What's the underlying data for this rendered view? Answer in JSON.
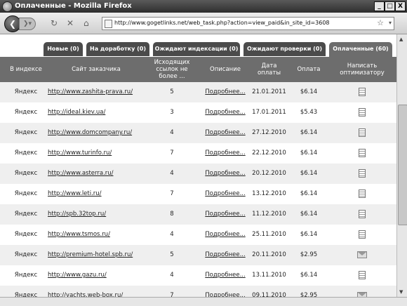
{
  "window": {
    "title": "Оплаченные - Mozilla Firefox",
    "buttons": [
      "_",
      "□",
      "X"
    ]
  },
  "nav": {
    "url": "http://www.gogetlinks.net/web_task.php?action=view_paid&in_site_id=3608",
    "icons": [
      "back-icon",
      "forward-icon",
      "reload-icon",
      "stop-icon",
      "home-icon",
      "star-icon"
    ]
  },
  "tabs": [
    {
      "label": "Новые (0)"
    },
    {
      "label": "На доработку (0)"
    },
    {
      "label": "Ожидают индексации (0)"
    },
    {
      "label": "Ожидают проверки (0)"
    },
    {
      "label": "Оплаченные (60)"
    }
  ],
  "table": {
    "headers": [
      "В индексе",
      "Сайт заказчика",
      "Исходящих ссылок не более ...",
      "Описание",
      "Дата оплаты",
      "Оплата",
      "Написать оптимизатору"
    ],
    "rows": [
      {
        "idx": "Яндекс",
        "site": "http://www.zashita-prava.ru/",
        "links": "5",
        "desc": "Подробнее...",
        "date": "21.01.2011",
        "pay": "$6.14",
        "msg": "note"
      },
      {
        "idx": "Яндекс",
        "site": "http://ideal.kiev.ua/",
        "links": "3",
        "desc": "Подробнее...",
        "date": "17.01.2011",
        "pay": "$5.43",
        "msg": "note"
      },
      {
        "idx": "Яндекс",
        "site": "http://www.domcompany.ru/",
        "links": "4",
        "desc": "Подробнее...",
        "date": "27.12.2010",
        "pay": "$6.14",
        "msg": "note"
      },
      {
        "idx": "Яндекс",
        "site": "http://www.turinfo.ru/",
        "links": "7",
        "desc": "Подробнее...",
        "date": "22.12.2010",
        "pay": "$6.14",
        "msg": "note"
      },
      {
        "idx": "Яндекс",
        "site": "http://www.asterra.ru/",
        "links": "4",
        "desc": "Подробнее...",
        "date": "20.12.2010",
        "pay": "$6.14",
        "msg": "note"
      },
      {
        "idx": "Яндекс",
        "site": "http://www.leti.ru/",
        "links": "7",
        "desc": "Подробнее...",
        "date": "13.12.2010",
        "pay": "$6.14",
        "msg": "note"
      },
      {
        "idx": "Яндекс",
        "site": "http://spb.32top.ru/",
        "links": "8",
        "desc": "Подробнее...",
        "date": "11.12.2010",
        "pay": "$6.14",
        "msg": "note"
      },
      {
        "idx": "Яндекс",
        "site": "http://www.tsmos.ru/",
        "links": "4",
        "desc": "Подробнее...",
        "date": "25.11.2010",
        "pay": "$6.14",
        "msg": "note"
      },
      {
        "idx": "Яндекс",
        "site": "http://premium-hotel.spb.ru/",
        "links": "5",
        "desc": "Подробнее...",
        "date": "20.11.2010",
        "pay": "$2.95",
        "msg": "envelope"
      },
      {
        "idx": "Яндекс",
        "site": "http://www.gazu.ru/",
        "links": "4",
        "desc": "Подробнее...",
        "date": "13.11.2010",
        "pay": "$6.14",
        "msg": "note"
      },
      {
        "idx": "Яндекс",
        "site": "http://yachts.web-box.ru/",
        "links": "7",
        "desc": "Подробнее...",
        "date": "09.11.2010",
        "pay": "$2.95",
        "msg": "envelope"
      }
    ]
  }
}
